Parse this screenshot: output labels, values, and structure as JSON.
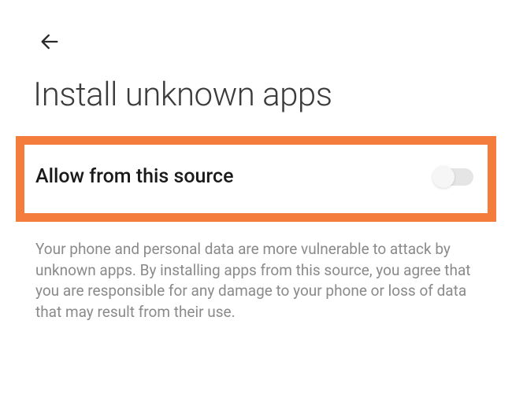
{
  "header": {
    "title": "Install unknown apps"
  },
  "setting": {
    "label": "Allow from this source",
    "enabled": false
  },
  "description": "Your phone and personal data are more vulnerable to attack by unknown apps. By installing apps from this source, you agree that you are responsible for any damage to your phone or loss of data that may result from their use.",
  "highlight_color": "#f47d3e"
}
